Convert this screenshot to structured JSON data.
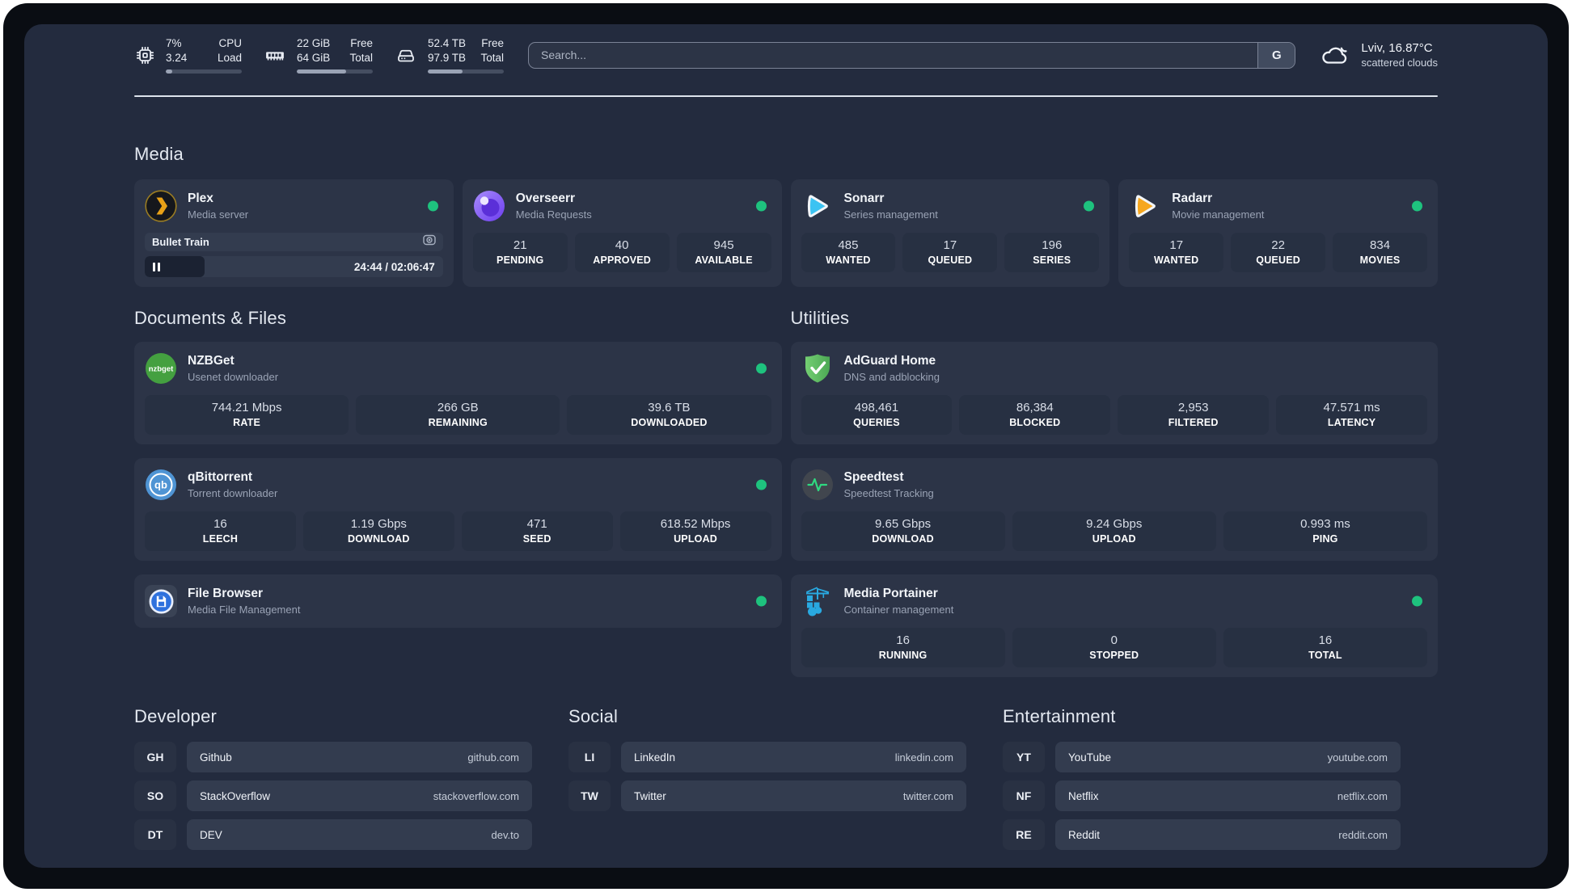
{
  "topbar": {
    "widgets": [
      {
        "id": "cpu",
        "icon": "cpu-icon",
        "rows": [
          {
            "value": "7%",
            "label": "CPU"
          },
          {
            "value": "3.24",
            "label": "Load"
          }
        ],
        "progress_pct": 8
      },
      {
        "id": "memory",
        "icon": "memory-icon",
        "rows": [
          {
            "value": "22 GiB",
            "label": "Free"
          },
          {
            "value": "64 GiB",
            "label": "Total"
          }
        ],
        "progress_pct": 65
      },
      {
        "id": "disk",
        "icon": "disk-icon",
        "rows": [
          {
            "value": "52.4 TB",
            "label": "Free"
          },
          {
            "value": "97.9 TB",
            "label": "Total"
          }
        ],
        "progress_pct": 46
      }
    ],
    "search": {
      "placeholder": "Search...",
      "provider_button": "G"
    },
    "weather": {
      "icon": "cloud-icon",
      "headline": "Lviv, 16.87°C",
      "condition": "scattered clouds"
    }
  },
  "sections": {
    "media": {
      "title": "Media"
    },
    "documents": {
      "title": "Documents & Files"
    },
    "utilities": {
      "title": "Utilities"
    }
  },
  "services": {
    "media": [
      {
        "id": "plex",
        "name": "Plex",
        "description": "Media server",
        "icon": "plex-icon",
        "online": true,
        "player": {
          "title": "Bullet Train",
          "time": "24:44 / 02:06:47",
          "progress_pct": 20
        }
      },
      {
        "id": "overseerr",
        "name": "Overseerr",
        "description": "Media Requests",
        "icon": "overseerr-icon",
        "online": true,
        "stats": [
          {
            "value": "21",
            "label": "PENDING"
          },
          {
            "value": "40",
            "label": "APPROVED"
          },
          {
            "value": "945",
            "label": "AVAILABLE"
          }
        ]
      },
      {
        "id": "sonarr",
        "name": "Sonarr",
        "description": "Series management",
        "icon": "sonarr-icon",
        "online": true,
        "stats": [
          {
            "value": "485",
            "label": "WANTED"
          },
          {
            "value": "17",
            "label": "QUEUED"
          },
          {
            "value": "196",
            "label": "SERIES"
          }
        ]
      },
      {
        "id": "radarr",
        "name": "Radarr",
        "description": "Movie management",
        "icon": "radarr-icon",
        "online": true,
        "stats": [
          {
            "value": "17",
            "label": "WANTED"
          },
          {
            "value": "22",
            "label": "QUEUED"
          },
          {
            "value": "834",
            "label": "MOVIES"
          }
        ]
      }
    ],
    "documents": [
      {
        "id": "nzbget",
        "name": "NZBGet",
        "description": "Usenet downloader",
        "icon": "nzbget-icon",
        "online": true,
        "stats": [
          {
            "value": "744.21 Mbps",
            "label": "RATE"
          },
          {
            "value": "266 GB",
            "label": "REMAINING"
          },
          {
            "value": "39.6 TB",
            "label": "DOWNLOADED"
          }
        ]
      },
      {
        "id": "qbittorrent",
        "name": "qBittorrent",
        "description": "Torrent downloader",
        "icon": "qbittorrent-icon",
        "online": true,
        "stats": [
          {
            "value": "16",
            "label": "LEECH"
          },
          {
            "value": "1.19 Gbps",
            "label": "DOWNLOAD"
          },
          {
            "value": "471",
            "label": "SEED"
          },
          {
            "value": "618.52 Mbps",
            "label": "UPLOAD"
          }
        ]
      },
      {
        "id": "filebrowser",
        "name": "File Browser",
        "description": "Media File Management",
        "icon": "filebrowser-icon",
        "online": true
      }
    ],
    "utilities": [
      {
        "id": "adguard",
        "name": "AdGuard Home",
        "description": "DNS and adblocking",
        "icon": "adguard-icon",
        "online": false,
        "stats": [
          {
            "value": "498,461",
            "label": "QUERIES"
          },
          {
            "value": "86,384",
            "label": "BLOCKED"
          },
          {
            "value": "2,953",
            "label": "FILTERED"
          },
          {
            "value": "47.571 ms",
            "label": "LATENCY"
          }
        ]
      },
      {
        "id": "speedtest",
        "name": "Speedtest",
        "description": "Speedtest Tracking",
        "icon": "speedtest-icon",
        "online": false,
        "stats": [
          {
            "value": "9.65 Gbps",
            "label": "DOWNLOAD"
          },
          {
            "value": "9.24 Gbps",
            "label": "UPLOAD"
          },
          {
            "value": "0.993 ms",
            "label": "PING"
          }
        ]
      },
      {
        "id": "portainer",
        "name": "Media Portainer",
        "description": "Container management",
        "icon": "portainer-icon",
        "online": true,
        "stats": [
          {
            "value": "16",
            "label": "RUNNING"
          },
          {
            "value": "0",
            "label": "STOPPED"
          },
          {
            "value": "16",
            "label": "TOTAL"
          }
        ]
      }
    ]
  },
  "bookmarks": [
    {
      "title": "Developer",
      "items": [
        {
          "abbr": "GH",
          "name": "Github",
          "url": "github.com"
        },
        {
          "abbr": "SO",
          "name": "StackOverflow",
          "url": "stackoverflow.com"
        },
        {
          "abbr": "DT",
          "name": "DEV",
          "url": "dev.to"
        }
      ]
    },
    {
      "title": "Social",
      "items": [
        {
          "abbr": "LI",
          "name": "LinkedIn",
          "url": "linkedin.com"
        },
        {
          "abbr": "TW",
          "name": "Twitter",
          "url": "twitter.com"
        }
      ]
    },
    {
      "title": "Entertainment",
      "items": [
        {
          "abbr": "YT",
          "name": "YouTube",
          "url": "youtube.com"
        },
        {
          "abbr": "NF",
          "name": "Netflix",
          "url": "netflix.com"
        },
        {
          "abbr": "RE",
          "name": "Reddit",
          "url": "reddit.com"
        }
      ]
    }
  ],
  "colors": {
    "status_online": "#1ec27e",
    "background": "#232b3e",
    "card": "#2c3447"
  }
}
